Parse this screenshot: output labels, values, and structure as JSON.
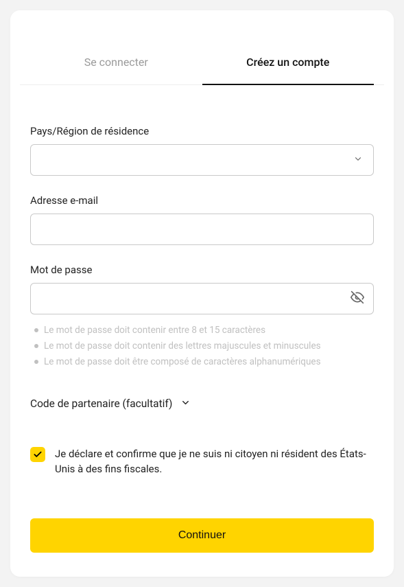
{
  "tabs": {
    "login": "Se connecter",
    "signup": "Créez un compte"
  },
  "fields": {
    "country_label": "Pays/Région de résidence",
    "country_value": "",
    "email_label": "Adresse e-mail",
    "email_value": "",
    "password_label": "Mot de passe",
    "password_value": ""
  },
  "password_rules": [
    "Le mot de passe doit contenir entre 8 et 15 caractères",
    "Le mot de passe doit contenir des lettres majuscules et minuscules",
    "Le mot de passe doit être composé de caractères alphanumériques"
  ],
  "partner": {
    "label": "Code de partenaire (facultatif)"
  },
  "consent": {
    "text": "Je déclare et confirme que je ne suis ni citoyen ni résident des États-Unis à des fins fiscales.",
    "checked": true
  },
  "continue_label": "Continuer"
}
